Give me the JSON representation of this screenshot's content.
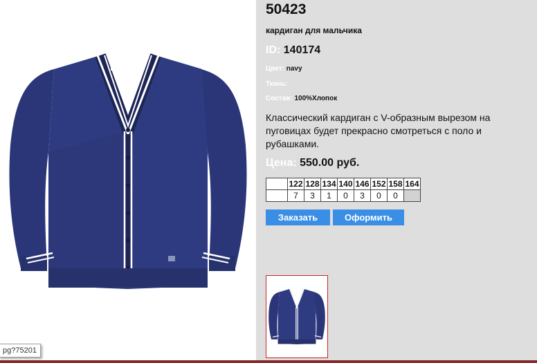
{
  "product": {
    "model": "50423",
    "subtitle": "кардиган для мальчика",
    "id_label": "ID:",
    "id_value": "140174",
    "color_label": "Цвет:",
    "color_value": "navy",
    "fabric_label": "Ткань:",
    "fabric_value": "",
    "composition_label": "Состав:",
    "composition_value": "100%Хлопок",
    "description": "Классический кардиган с V-образным вырезом на пуговицах будет прекрасно смотреться с поло и рубашками.",
    "price_label": "Цена:",
    "price_value": "550.00 руб."
  },
  "sizes": {
    "headers": [
      "122",
      "128",
      "134",
      "140",
      "146",
      "152",
      "158",
      "164"
    ],
    "quantities": [
      "7",
      "3",
      "1",
      "0",
      "3",
      "0",
      "0",
      ""
    ]
  },
  "buttons": {
    "order": "Заказать",
    "checkout": "Оформить"
  },
  "tooltip": {
    "text": "pg?75201"
  },
  "colors": {
    "panel_bg": "#dedede",
    "button_bg": "#3a8ee6",
    "garment_navy": "#2b3679",
    "thumb_border": "#cc2222"
  },
  "icons": {
    "main_image": "cardigan-photo",
    "thumbnail": "cardigan-thumbnail"
  }
}
